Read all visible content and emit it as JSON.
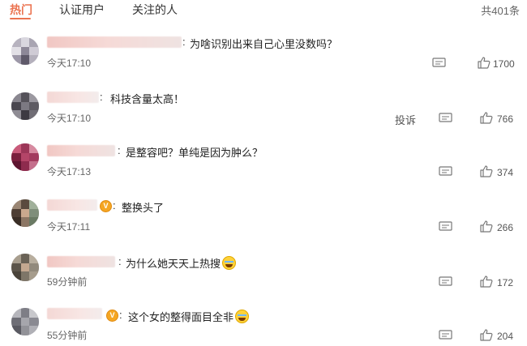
{
  "tabs": [
    {
      "label": "热门",
      "active": true
    },
    {
      "label": "认证用户",
      "active": false
    },
    {
      "label": "关注的人",
      "active": false
    }
  ],
  "total_count": "共401条",
  "colors": {
    "accent": "#eb7350",
    "badge": "#f5a623"
  },
  "comments": [
    {
      "text": "为啥识别出来自己心里没数吗？",
      "time": "今天17:10",
      "likes": "1700",
      "has_report": false
    },
    {
      "text": "科技含量太高！",
      "time": "今天17:10",
      "likes": "766",
      "report_label": "投诉",
      "has_report": true
    },
    {
      "text": "是整容吧？单纯是因为肿么？",
      "time": "今天17:13",
      "likes": "374",
      "has_report": false
    },
    {
      "text": "整换头了",
      "time": "今天17:11",
      "likes": "266",
      "has_report": false
    },
    {
      "text": "为什么她天天上热搜",
      "time": "59分钟前",
      "likes": "172",
      "has_report": false
    },
    {
      "text": "这个女的整得面目全非",
      "time": "55分钟前",
      "likes": "204",
      "has_report": false
    }
  ],
  "icons": {
    "reply": "comment-icon",
    "like": "thumbs-up-icon",
    "emoji": "laugh-cry-emoji-icon"
  }
}
